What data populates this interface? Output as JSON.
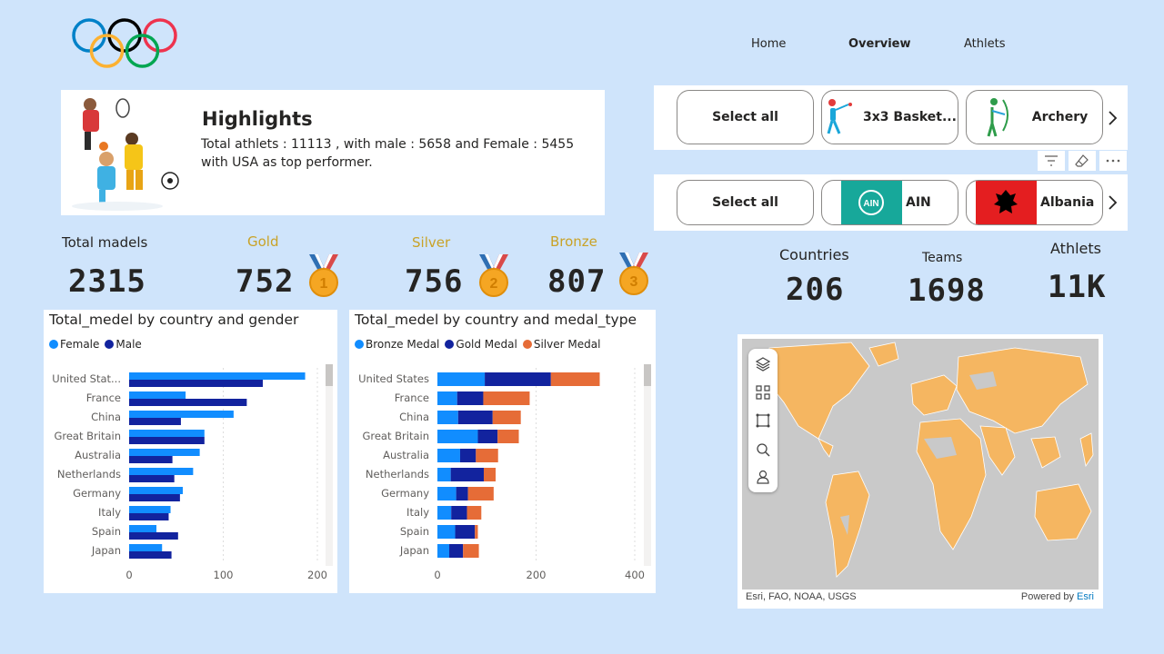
{
  "nav": {
    "home": "Home",
    "overview": "Overview",
    "athletes": "Athlets"
  },
  "highlights": {
    "title": "Highlights",
    "text": "Total athlets : 11113 , with male : 5658 and Female : 5455 with USA as top performer."
  },
  "kpis": {
    "total_label": "Total madels",
    "total_value": "2315",
    "gold_label": "Gold",
    "gold_value": "752",
    "silver_label": "Silver",
    "silver_value": "756",
    "bronze_label": "Bronze",
    "bronze_value": "807",
    "countries_label": "Countries",
    "countries_value": "206",
    "teams_label": "Teams",
    "teams_value": "1698",
    "athletes_label": "Athlets",
    "athletes_value": "11K"
  },
  "medal_badges": {
    "gold": "1",
    "silver": "2",
    "bronze": "3"
  },
  "sport_slicer": {
    "select_all": "Select all",
    "items": [
      "3x3 Basket...",
      "Archery"
    ]
  },
  "country_slicer": {
    "select_all": "Select all",
    "items": [
      "AIN",
      "Albania"
    ]
  },
  "colors": {
    "female": "#118dff",
    "male": "#12239e",
    "bronze": "#118dff",
    "gold": "#12239e",
    "silver": "#e66c37",
    "gold_text": "#c9a227",
    "map_fill": "#f5b661"
  },
  "chart_data": [
    {
      "type": "bar",
      "title": "Total_medel by country and gender",
      "categories": [
        "United Stat...",
        "France",
        "China",
        "Great Britain",
        "Australia",
        "Netherlands",
        "Germany",
        "Italy",
        "Spain",
        "Japan"
      ],
      "series": [
        {
          "name": "Female",
          "values": [
            187,
            60,
            111,
            80,
            75,
            68,
            57,
            44,
            29,
            35
          ]
        },
        {
          "name": "Male",
          "values": [
            142,
            125,
            55,
            80,
            46,
            48,
            54,
            42,
            52,
            45
          ]
        }
      ],
      "xticks": [
        "0",
        "100",
        "200"
      ],
      "xlim": [
        0,
        200
      ],
      "legend_position": "top-left"
    },
    {
      "type": "bar",
      "stacked": true,
      "title": "Total_medel by country and medal_type",
      "categories": [
        "United States",
        "France",
        "China",
        "Great Britain",
        "Australia",
        "Netherlands",
        "Germany",
        "Italy",
        "Spain",
        "Japan"
      ],
      "series": [
        {
          "name": "Bronze Medal",
          "values": [
            96,
            40,
            42,
            82,
            46,
            27,
            38,
            28,
            36,
            24
          ]
        },
        {
          "name": "Gold Medal",
          "values": [
            134,
            53,
            70,
            40,
            32,
            67,
            24,
            32,
            40,
            28
          ]
        },
        {
          "name": "Silver Medal",
          "values": [
            99,
            94,
            57,
            43,
            45,
            24,
            52,
            29,
            6,
            32
          ]
        }
      ],
      "xticks": [
        "0",
        "200",
        "400"
      ],
      "xlim": [
        0,
        400
      ],
      "legend_position": "top-left"
    }
  ],
  "map": {
    "attribution": "Esri, FAO, NOAA, USGS",
    "powered_by": "Powered by",
    "esri": "Esri"
  }
}
